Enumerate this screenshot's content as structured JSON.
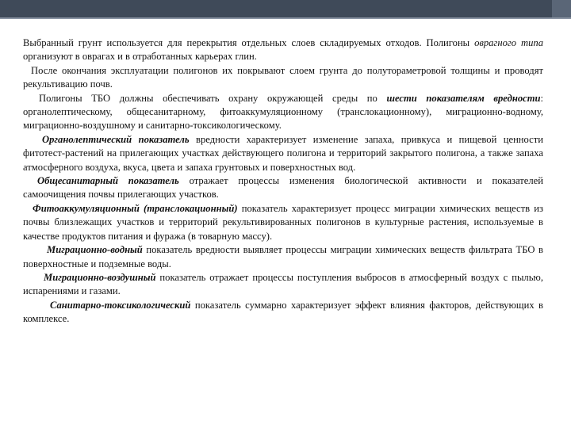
{
  "paragraphs": [
    {
      "parts": [
        "Выбранный грунт используется для перекрытия отдельных слоев складируемых отходов. Полигоны ",
        "оврагного типа",
        " организуют в оврагах и в отработанных карьерах глин."
      ]
    },
    {
      "text": "После окончания эксплуатации полигонов их покрывают слоем грунта до полутораметровой толщины и проводят рекультивацию почв."
    },
    {
      "parts": [
        "Полигоны ТБО должны обеспечивать охрану окружающей среды по ",
        "шести показателям вредности",
        ": органолептическому, общесанитарному, фитоаккумуляционному (транслокационному), миграционно-водному, миграционно-воздушному и санитарно-токсикологическому."
      ]
    },
    {
      "parts": [
        "Органолептический показатель",
        " вредности характеризует изменение запаха, привкуса и пищевой ценности фитотест-растений на прилегающих участках действующего полигона и территорий закрытого полигона, а также запаха атмосферного воздуха, вкуса, цвета и запаха грунтовых и поверхностных вод."
      ]
    },
    {
      "parts": [
        "Общесанитарный показатель",
        " отражает процессы изменения биологической активности и показателей самоочищения почвы прилегающих участков."
      ]
    },
    {
      "parts": [
        "Фитоаккумуляционный (транслокационный)",
        " показатель характеризует процесс миграции химических веществ из почвы близлежащих участков и территорий рекультивированных полигонов в культурные растения, используемые в качестве продуктов питания и фуража (в товарную массу)."
      ]
    },
    {
      "parts": [
        "Миграционно-водный",
        " показатель вредности выявляет процессы миграции химических веществ фильтрата ТБО в поверхностные и подземные воды."
      ]
    },
    {
      "parts": [
        "Миграционно-воздушный",
        " показатель отражает процессы поступления выбросов в атмосферный воздух с пылью, испарениями и газами."
      ]
    },
    {
      "parts": [
        "Санитарно-токсикологический",
        " показатель суммарно характеризует эффект влияния факторов, действующих в комплексе."
      ]
    }
  ],
  "colors": {
    "header_bar": "#3f4a59",
    "header_accent": "#5a6677",
    "text": "#111111"
  }
}
